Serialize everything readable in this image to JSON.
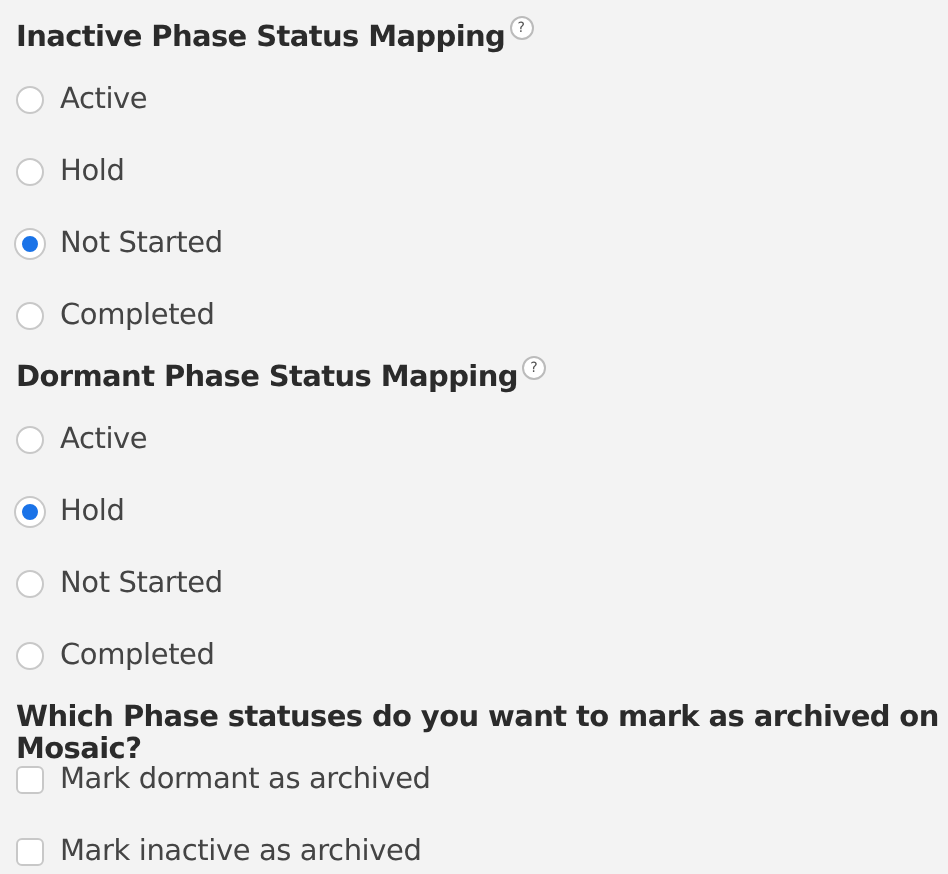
{
  "radio_groups": [
    {
      "title": "Inactive Phase Status Mapping",
      "help": "?",
      "options": [
        {
          "label": "Active",
          "selected": false
        },
        {
          "label": "Hold",
          "selected": false
        },
        {
          "label": "Not Started",
          "selected": true
        },
        {
          "label": "Completed",
          "selected": false
        }
      ]
    },
    {
      "title": "Dormant Phase Status Mapping",
      "help": "?",
      "options": [
        {
          "label": "Active",
          "selected": false
        },
        {
          "label": "Hold",
          "selected": true
        },
        {
          "label": "Not Started",
          "selected": false
        },
        {
          "label": "Completed",
          "selected": false
        }
      ]
    }
  ],
  "archive": {
    "title": "Which Phase statuses do you want to mark as archived on Mosaic?",
    "options": [
      {
        "label": "Mark dormant as archived",
        "checked": false
      },
      {
        "label": "Mark inactive as archived",
        "checked": false
      }
    ]
  }
}
